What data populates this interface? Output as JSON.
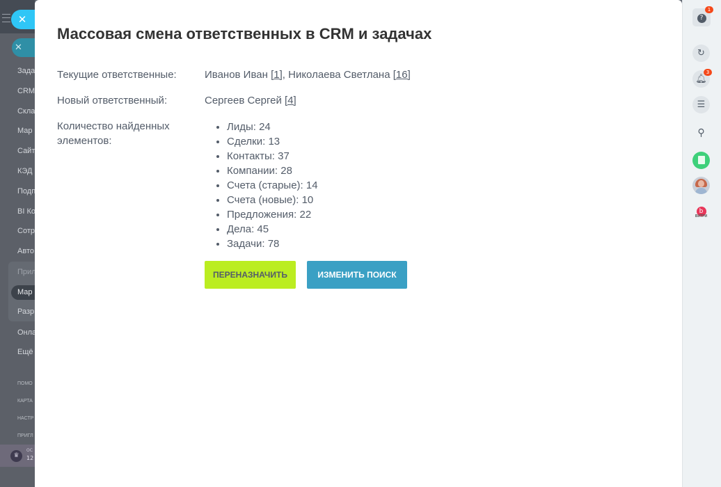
{
  "left_nav": {
    "items": [
      "Зада",
      "CRM",
      "Скла",
      "Мар",
      "Сайт",
      "КЭД",
      "Подп",
      "BI Ко",
      "Сотр",
      "Авто",
      "Прил",
      "Мар",
      "Разр",
      "Онла",
      "Ещё"
    ],
    "small_items": [
      "ПОМО",
      "КАРТА",
      "НАСТР",
      "ПРИГЛ"
    ],
    "bottom_label": "ОС",
    "bottom_value": "12"
  },
  "modal": {
    "title": "Массовая смена ответственных в CRM и задачах",
    "current_label": "Текущие ответственные:",
    "current_users": [
      {
        "name": "Иванов Иван",
        "count": "[1]"
      },
      {
        "name": "Николаева Светлана",
        "count": "[16]"
      }
    ],
    "separator": ",",
    "new_label": "Новый ответственный:",
    "new_user": {
      "name": "Сергеев Сергей",
      "count": "[4]"
    },
    "found_label": "Количество найденных элементов:",
    "found_items": [
      "Лиды: 24",
      "Сделки: 13",
      "Контакты: 37",
      "Компании: 28",
      "Счета (старые): 14",
      "Счета (новые): 10",
      "Предложения: 22",
      "Дела: 45",
      "Задачи: 78"
    ],
    "reassign_button": "Переназначить",
    "change_search_button": "Изменить поиск"
  },
  "right_bar": {
    "help_badge": "1",
    "notifications_badge": "3",
    "vitri_caption": "ВИТРИ"
  },
  "colors": {
    "accent_green": "#bbed21",
    "accent_blue": "#3aa0c4",
    "close_blue": "#2fc6f6",
    "badge_red": "#f54819"
  }
}
